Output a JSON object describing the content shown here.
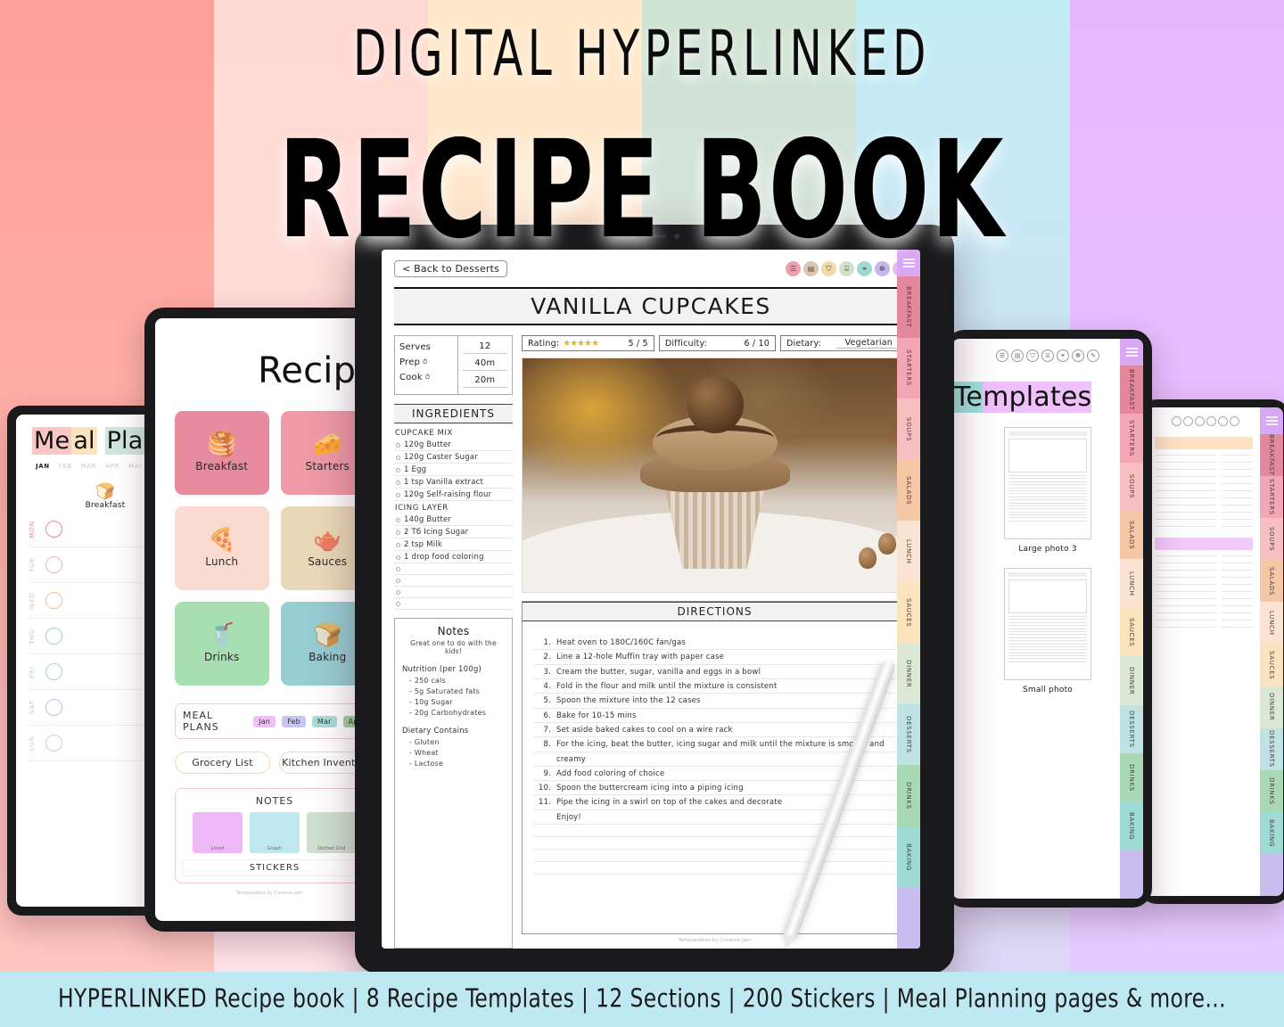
{
  "title": {
    "sub": "DIGITAL HYPERLINKED",
    "main": "RECIPE BOOK"
  },
  "banner": {
    "text": "HYPERLINKED Recipe book | 8 Recipe Templates | 12 Sections | 200 Stickers | Meal Planning pages & more..."
  },
  "background": {
    "stripes": [
      "#ff9e96",
      "#ffd8d0",
      "#ffe9c9",
      "#cfe3d2",
      "#c2ecf4",
      "#e8b6ff"
    ]
  },
  "main_tablet": {
    "back_button": "< Back to Desserts",
    "recipe_title": "VANILLA CUPCAKES",
    "toolbar": [
      {
        "name": "home-icon",
        "glyph": "☰",
        "color": "#f0a0ad"
      },
      {
        "name": "book-icon",
        "glyph": "▤",
        "color": "#d9c6b0"
      },
      {
        "name": "cart-icon",
        "glyph": "⛉",
        "color": "#f2d9a8"
      },
      {
        "name": "notes-icon",
        "glyph": "⌸",
        "color": "#cfe3c6"
      },
      {
        "name": "link-icon",
        "glyph": "⚭",
        "color": "#9fd9d4"
      },
      {
        "name": "sticker-icon",
        "glyph": "❁",
        "color": "#c3b7ef"
      },
      {
        "name": "pen-icon",
        "glyph": "✎",
        "color": "#e9b7ee"
      }
    ],
    "meta": {
      "labels": [
        "Serves",
        "Prep",
        "Cook"
      ],
      "values": [
        "12",
        "40m",
        "20m"
      ]
    },
    "chips": {
      "rating_label": "Rating:",
      "rating_stars": "★★★★★",
      "rating_value": "5 / 5",
      "difficulty_label": "Difficulty:",
      "difficulty_value": "6 / 10",
      "dietary_label": "Dietary:",
      "dietary_value": "Vegetarian"
    },
    "ingredients_header": "INGREDIENTS",
    "ingredients": [
      {
        "group": "CUPCAKE MIX",
        "items": [
          "120g Butter",
          "120g Caster Sugar",
          "1 Egg",
          "1 tsp Vanilla extract",
          "120g Self-raising flour"
        ]
      },
      {
        "group": "ICING LAYER",
        "items": [
          "140g Butter",
          "2 Tб Icing Sugar",
          "2 tsp Milk",
          "1 drop food coloring",
          "",
          "",
          "",
          ""
        ]
      }
    ],
    "notes": {
      "title": "Notes",
      "subtitle": "Great one to do with the kids!",
      "nutrition_header": "Nutrition (per 100g)",
      "nutrition": [
        "- 250 cals",
        "- 5g Saturated fats",
        "- 10g Sugar",
        "- 20g Carbohydrates"
      ],
      "dietary_header": "Dietary Contains",
      "dietary": [
        "- Gluten",
        "- Wheat",
        "- Lactose"
      ]
    },
    "directions_header": "DIRECTIONS",
    "directions": [
      {
        "n": "1.",
        "t": "Heat oven to 180C/160C fan/gas"
      },
      {
        "n": "2.",
        "t": "Line a 12-hole Muffin tray with paper case"
      },
      {
        "n": "3.",
        "t": "Cream the butter, sugar, vanilla and eggs in a bowl"
      },
      {
        "n": "4.",
        "t": "Fold in the flour and milk until the mixture is consistent"
      },
      {
        "n": "5.",
        "t": "Spoon the mixture into the 12 cases"
      },
      {
        "n": "6.",
        "t": "Bake for 10-15 mins"
      },
      {
        "n": "7.",
        "t": "Set aside baked cakes to cool on a wire rack"
      },
      {
        "n": "8.",
        "t": "For the icing, beat the butter, icing sugar and milk until the mixture is smooth and"
      },
      {
        "n": "",
        "t": "creamy"
      },
      {
        "n": "9.",
        "t": "Add food coloring of choice"
      },
      {
        "n": "10.",
        "t": "Spoon the buttercream icing into a piping icing"
      },
      {
        "n": "11.",
        "t": "Pipe the icing in a swirl on top of the cakes and decorate"
      },
      {
        "n": "",
        "t": "Enjoy!"
      }
    ],
    "credit": "Templatables by Creative Jam",
    "photo_alt": "Chocolate hazelnut cupcake"
  },
  "section_tabs": [
    {
      "label": "BREAKFAST",
      "color": "#e4889c"
    },
    {
      "label": "STARTERS",
      "color": "#f3a7b5"
    },
    {
      "label": "SOUPS",
      "color": "#f7bfc2"
    },
    {
      "label": "SALADS",
      "color": "#f5c8a5"
    },
    {
      "label": "LUNCH",
      "color": "#fae3d3"
    },
    {
      "label": "SAUCES",
      "color": "#fbe3bd"
    },
    {
      "label": "DINNER",
      "color": "#dbe8d5"
    },
    {
      "label": "DESSERTS",
      "color": "#bfe2e4"
    },
    {
      "label": "DRINKS",
      "color": "#a8d8b4"
    },
    {
      "label": "BAKING",
      "color": "#9ddbd4"
    },
    {
      "label": "",
      "color": "#c9bdf0"
    }
  ],
  "menu_tab_color": "#d9a8f5",
  "index_tablet": {
    "title": "Recipe",
    "tiles": [
      {
        "label": "Breakfast",
        "icon": "pancakes-icon",
        "glyph": "🥞",
        "color": "#e88b9f"
      },
      {
        "label": "Starters",
        "icon": "cheese-icon",
        "glyph": "🧀",
        "color": "#f09aa8"
      },
      {
        "label": "Lunch",
        "icon": "pizza-icon",
        "glyph": "🍕",
        "color": "#fadbd2"
      },
      {
        "label": "Sauces",
        "icon": "gravy-boat-icon",
        "glyph": "🫖",
        "color": "#ead9b8"
      },
      {
        "label": "Drinks",
        "icon": "smoothie-icon",
        "glyph": "🥤",
        "color": "#a8dfb0"
      },
      {
        "label": "Baking",
        "icon": "bread-icon",
        "glyph": "🍞",
        "color": "#96cdd2"
      }
    ],
    "meal_plans_label": "MEAL PLANS",
    "month_chips": [
      {
        "label": "Jan",
        "color": "#eec0f5"
      },
      {
        "label": "Feb",
        "color": "#c8c5f2"
      },
      {
        "label": "Mar",
        "color": "#a9ddd8"
      },
      {
        "label": "Apr",
        "color": "#9ed4a0"
      }
    ],
    "buttons": [
      "Grocery List",
      "Kitchen Inventory"
    ],
    "notes_header": "NOTES",
    "note_types": [
      {
        "label": "Lined",
        "color": "#eeb8f7"
      },
      {
        "label": "Graph",
        "color": "#bfe7ee"
      },
      {
        "label": "Dotted Grid",
        "color": "#cfe0cf"
      }
    ],
    "stickers_label": "STICKERS",
    "credit": "Templatables by Creative Jam"
  },
  "mealplan_tablet": {
    "title": "Meal Plan",
    "months": [
      "JAN",
      "FEB",
      "MAR",
      "APR",
      "MAY"
    ],
    "active_month": "JAN",
    "column_label": "Breakfast",
    "column_icon": "pancakes-icon",
    "days": [
      {
        "label": "MON",
        "color": "#e08ca0"
      },
      {
        "label": "TUE",
        "color": "#efb1bb"
      },
      {
        "label": "WED",
        "color": "#f0c19a"
      },
      {
        "label": "THU",
        "color": "#a8ceb0"
      },
      {
        "label": "FRI",
        "color": "#a5d6d8"
      },
      {
        "label": "SAT",
        "color": "#c5bde3"
      },
      {
        "label": "SUN",
        "color": "#e7bfe8"
      }
    ]
  },
  "templates_tablet": {
    "title_part1": "Te",
    "title_part2": "mplates",
    "thumbs": [
      {
        "caption": "Large photo 3"
      },
      {
        "caption": "Small photo"
      }
    ]
  },
  "list_tablet": {
    "highlights": [
      {
        "color": "#fde2c4"
      },
      {
        "color": "#f3c8fb"
      }
    ]
  }
}
